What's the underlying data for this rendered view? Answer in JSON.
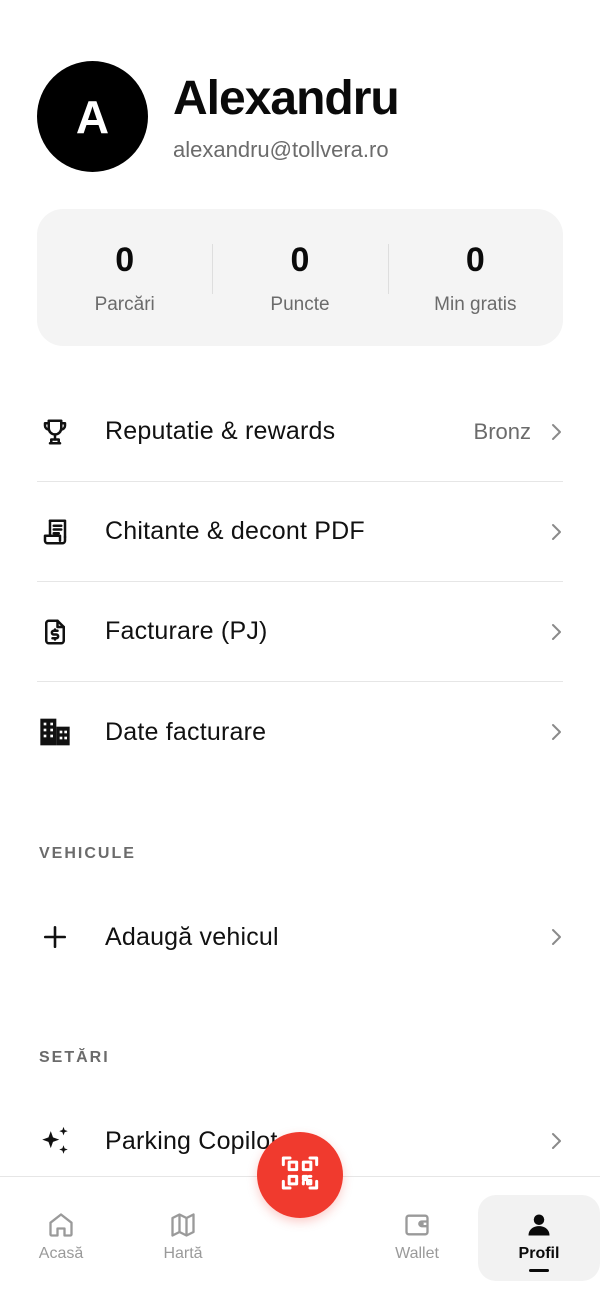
{
  "profile": {
    "initial": "A",
    "name": "Alexandru",
    "email": "alexandru@tollvera.ro"
  },
  "stats": [
    {
      "value": "0",
      "label": "Parcări"
    },
    {
      "value": "0",
      "label": "Puncte"
    },
    {
      "value": "0",
      "label": "Min gratis"
    }
  ],
  "menu": [
    {
      "icon": "trophy-icon",
      "label": "Reputatie & rewards",
      "value": "Bronz"
    },
    {
      "icon": "receipt-icon",
      "label": "Chitante & decont PDF"
    },
    {
      "icon": "invoice-dollar-icon",
      "label": "Facturare (PJ)"
    },
    {
      "icon": "building-icon",
      "label": "Date facturare"
    }
  ],
  "sections": {
    "vehicles": {
      "title": "VEHICULE",
      "add_label": "Adaugă vehicul"
    },
    "settings": {
      "title": "SETĂRI",
      "parking_label": "Parking Copilot"
    }
  },
  "nav": [
    {
      "icon": "home-icon",
      "label": "Acasă"
    },
    {
      "icon": "map-icon",
      "label": "Hartă"
    },
    {
      "icon": "wallet-icon",
      "label": "Wallet"
    },
    {
      "icon": "user-icon",
      "label": "Profil",
      "active": true
    }
  ],
  "fab": {
    "icon": "qr-scan-icon"
  },
  "colors": {
    "accent": "#f03a2e",
    "text": "#111111",
    "muted": "#6b6b6b",
    "card": "#f4f4f4"
  }
}
